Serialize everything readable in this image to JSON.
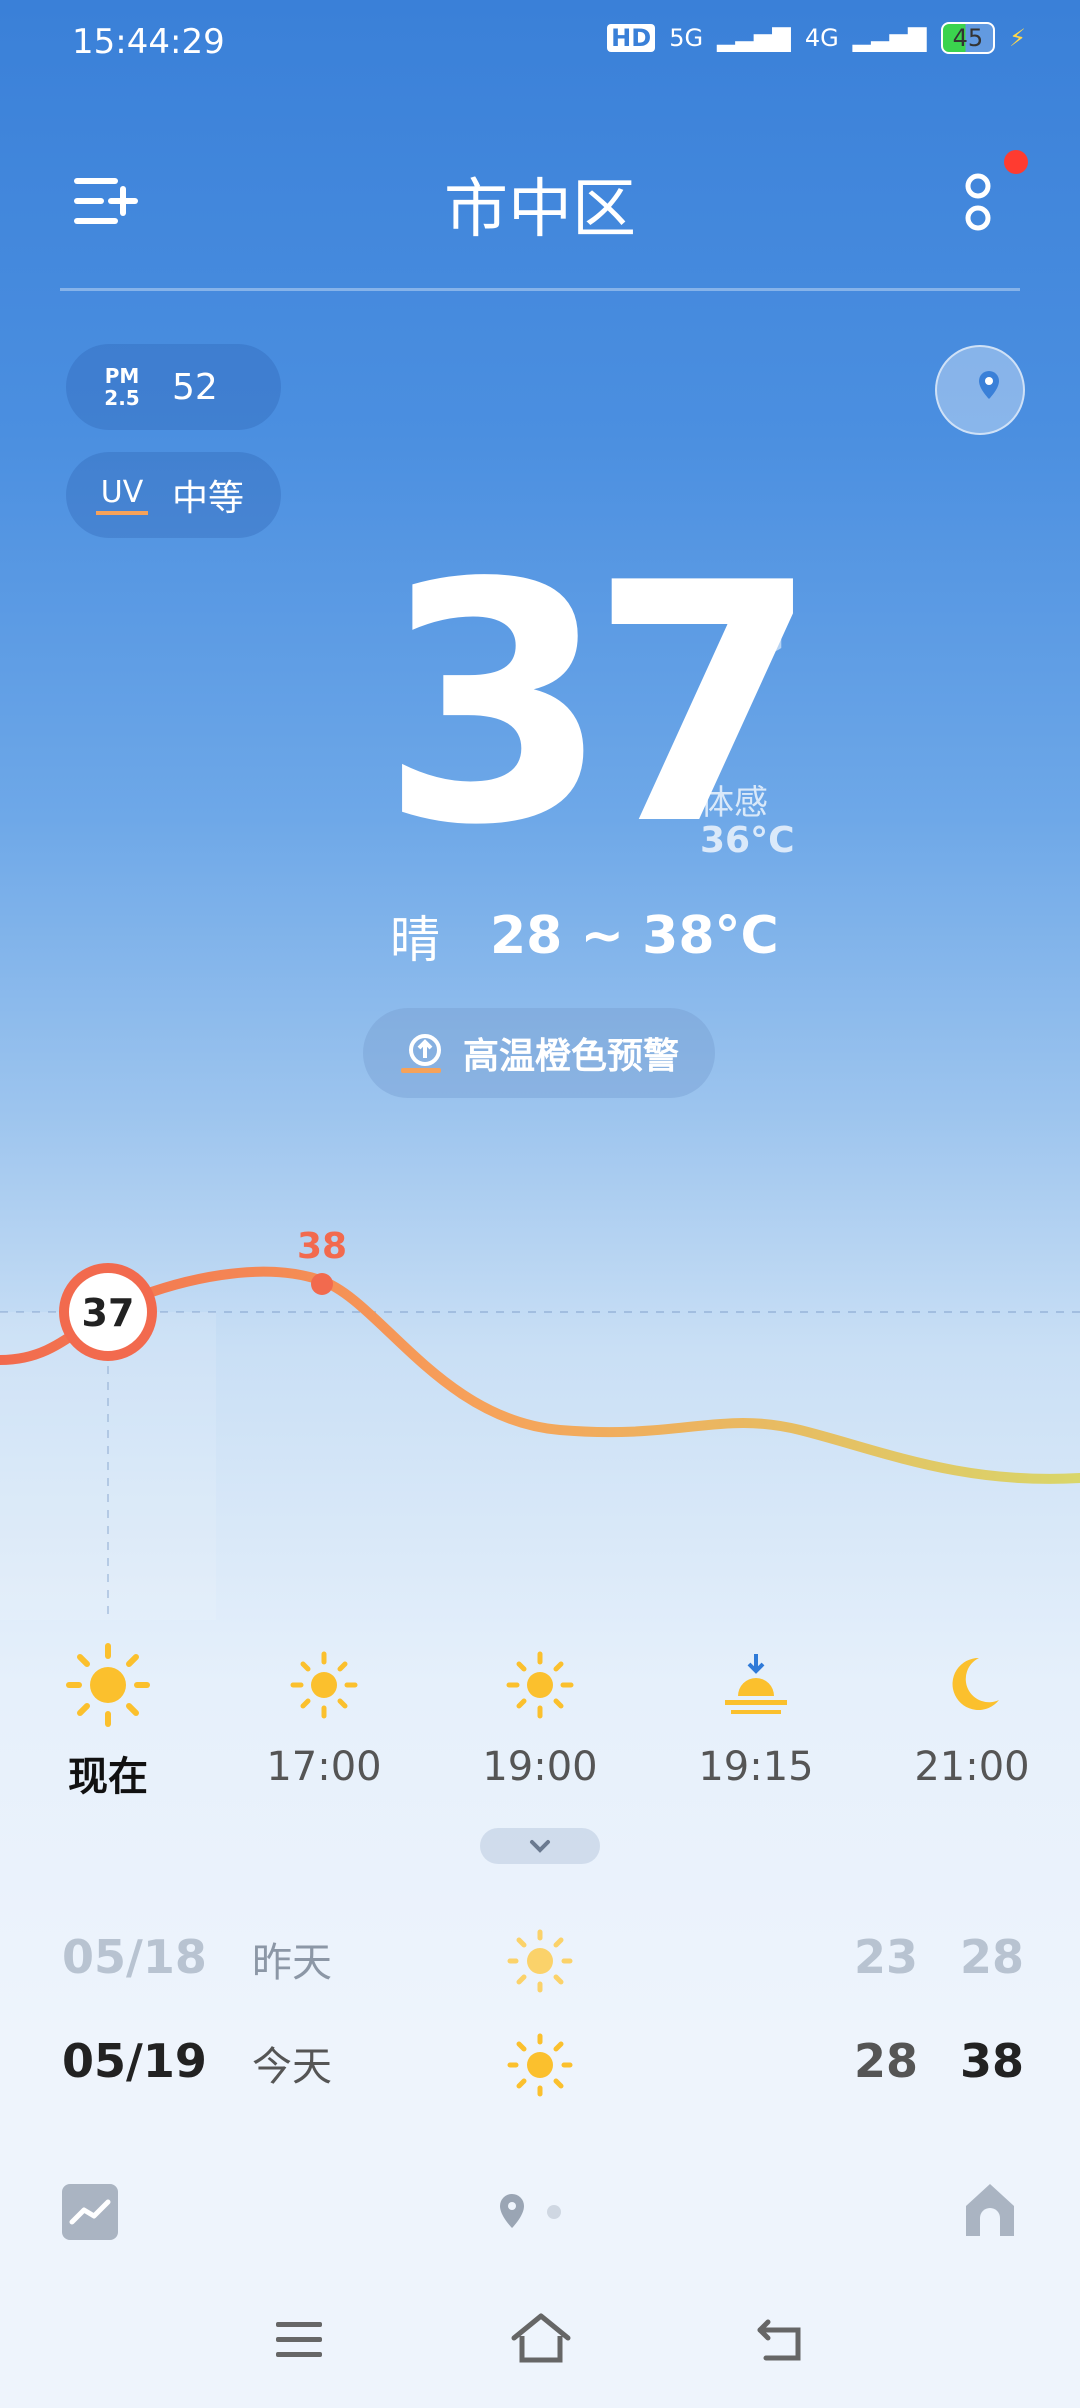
{
  "status_bar": {
    "time": "15:44:29",
    "network_labels": [
      "HD",
      "5G",
      "4G"
    ],
    "battery": "45"
  },
  "header": {
    "title": "市中区"
  },
  "air": {
    "pm_label": "PM\n2.5",
    "pm_value": "52",
    "uv_label": "UV",
    "uv_value": "中等"
  },
  "current": {
    "temperature": "37",
    "unit": "°C",
    "feels_label": "体感",
    "feels_value": "36°C",
    "condition": "晴",
    "range": "28 ~ 38°C"
  },
  "alert": {
    "text": "高温橙色预警"
  },
  "hourly_chart": {
    "current_temp": "37",
    "peak_temp": "38"
  },
  "hourly": [
    {
      "time": "现在",
      "icon": "sun-icon"
    },
    {
      "time": "17:00",
      "icon": "sun-icon"
    },
    {
      "time": "19:00",
      "icon": "sun-icon"
    },
    {
      "time": "19:15",
      "icon": "sunset-icon"
    },
    {
      "time": "21:00",
      "icon": "moon-icon"
    }
  ],
  "daily": [
    {
      "date": "05/18",
      "name": "昨天",
      "low": "23",
      "high": "28",
      "icon": "sun-icon"
    },
    {
      "date": "05/19",
      "name": "今天",
      "low": "28",
      "high": "38",
      "icon": "sun-icon"
    }
  ],
  "colors": {
    "sky_top": "#3a80d8",
    "accent_orange": "#f6a25a",
    "accent_red": "#f26a4e",
    "sun_yellow": "#fbc02d"
  }
}
